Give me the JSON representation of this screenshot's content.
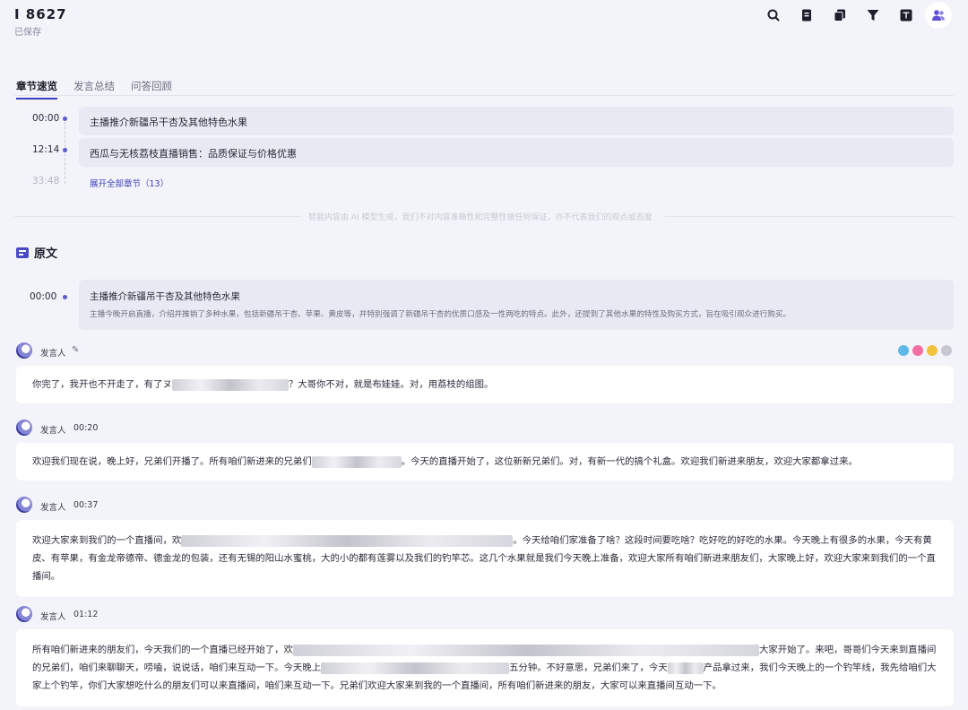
{
  "header": {
    "title": "I 8627",
    "status": "已保存",
    "toolbar": [
      {
        "name": "search-icon"
      },
      {
        "name": "document-icon"
      },
      {
        "name": "copy-icon"
      },
      {
        "name": "filter-icon"
      },
      {
        "name": "translate-icon"
      },
      {
        "name": "users-icon"
      }
    ]
  },
  "tabs": [
    "章节速览",
    "发言总结",
    "问答回顾"
  ],
  "chapters": [
    {
      "time": "00:00",
      "title": "主播推介新疆吊干杏及其他特色水果"
    },
    {
      "time": "12:14",
      "title": "西瓜与无核荔枝直播销售：品质保证与价格优惠"
    },
    {
      "time": "33:48",
      "title": ""
    }
  ],
  "expand_link": "展开全部章节（13）",
  "ai_notice": "智能内容由 AI 模型生成，我们不对内容准确性和完整性做任何保证，亦不代表我们的观点或态度",
  "original": {
    "heading": "原文",
    "chapter": {
      "time": "00:00",
      "title": "主播推介新疆吊干杏及其他特色水果",
      "summary": "主播今晚开启直播，介绍并推销了多种水果，包括新疆吊干杏、苹果、黄皮等，并特别强调了新疆吊干杏的优质口感及一性两吃的特点。此外，还提到了其他水果的特性及购买方式，旨在吸引观众进行购买。"
    }
  },
  "emoji_colors": [
    "#5fb8e8",
    "#f26fa0",
    "#f2c23c",
    "#c7c7d2"
  ],
  "speakers": [
    {
      "name": "发言人",
      "time": "",
      "edit_icon": "✎",
      "parts": [
        "你完了，我开也不开走了，有了ヌ",
        "",
        "？大哥你不对，就是布娃娃。对，用荔枝的组图。"
      ]
    },
    {
      "name": "发言人",
      "time": "00:20",
      "parts": [
        "欢迎我们现在说，晚上好，兄弟们开播了。所有咱们新进来的兄弟们",
        "",
        "。今天的直播开始了，这位新新兄弟们。对，有新一代的搞个礼盒。欢迎我们新进来朋友，欢迎大家都拿过来。"
      ]
    },
    {
      "name": "发言人",
      "time": "00:37",
      "parts": [
        "欢迎大家来到我们的一个直播间，欢",
        "",
        "。今天给咱们家准备了啥？这段时间要吃啥？吃好吃的好吃的水果。今天晚上有很多的水果，今天有黄皮、有苹果，有金龙帝德帝、德金龙的包装，还有无锡的阳山水蜜桃，大的小的都有莲雾以及我们的钓竿芯。这几个水果就是我们今天晚上准备，欢迎大家所有咱们新进来朋友们，大家晚上好，欢迎大家来到我们的一个直播间。"
      ]
    },
    {
      "name": "发言人",
      "time": "01:12",
      "parts": [
        "所有咱们新进来的朋友们，今天我们的一个直播已经开始了，欢",
        "",
        "大家开始了。来吧，哥哥们今天来到直播间的兄弟们，咱们来聊聊天，唠嗑，说说话，咱们来互动一下。今天晚上",
        "",
        "五分钟。不好意思，兄弟们来了，今天",
        "",
        "产品拿过来，我们今天晚上的一个钓竿线，我先给咱们大家上个钓竿，你们大家想吃什么的朋友们可以来直播间，咱们来互动一下。兄弟们欢迎大家来到我的一个直播间，所有咱们新进来的朋友，大家可以来直播间互动一下。"
      ]
    }
  ]
}
